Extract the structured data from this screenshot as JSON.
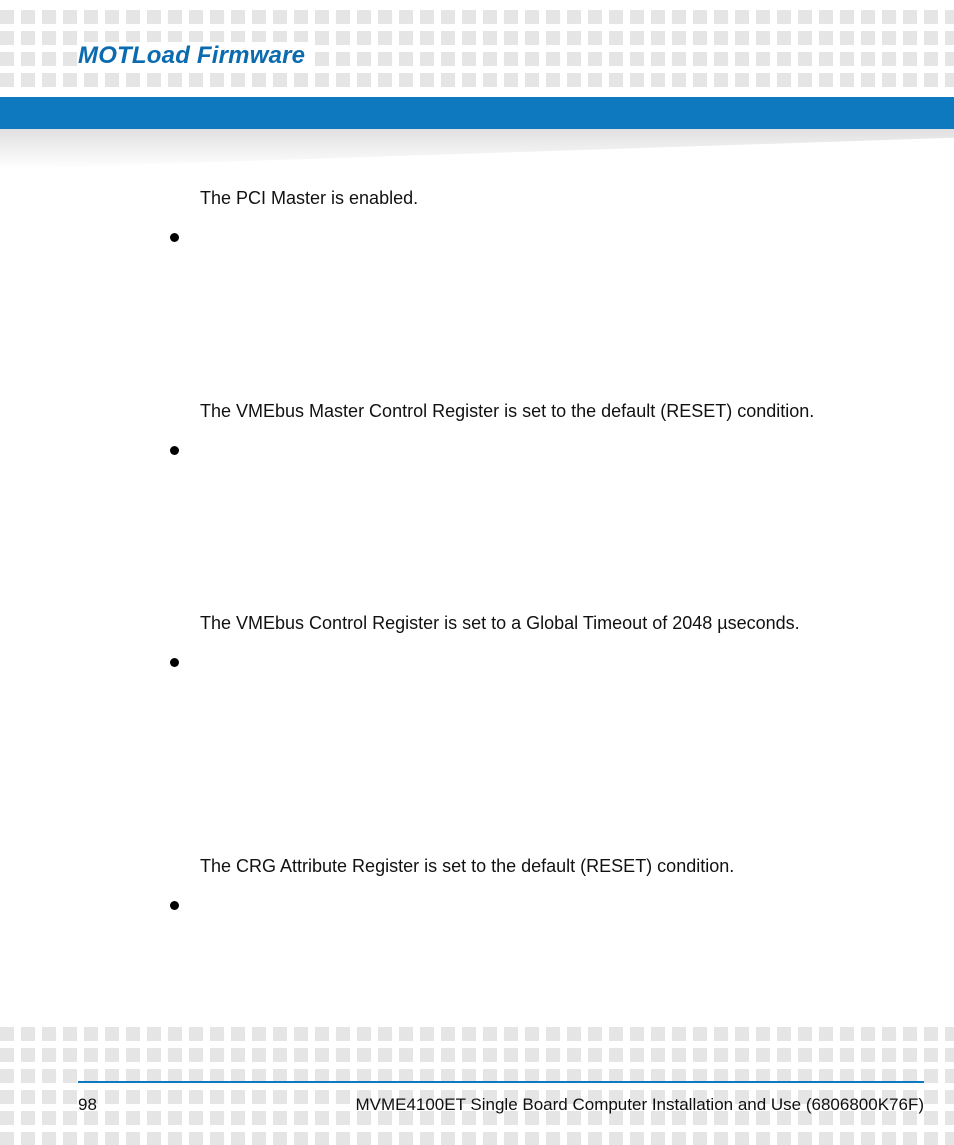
{
  "header": {
    "title": "MOTLoad Firmware"
  },
  "body": {
    "items": [
      "The PCI Master is enabled.",
      "The VMEbus Master Control Register is set to the default (RESET) condition.",
      "The VMEbus Control Register is set to a Global Timeout of 2048 µseconds.",
      "The CRG Attribute Register is set to the default (RESET) condition."
    ]
  },
  "footer": {
    "page": "98",
    "doc": "MVME4100ET Single Board Computer Installation and Use (6806800K76F)"
  }
}
